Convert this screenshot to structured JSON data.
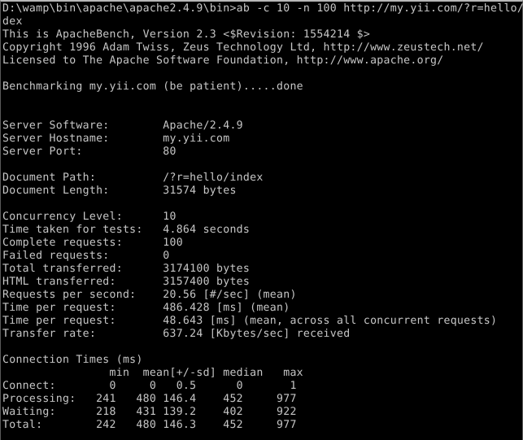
{
  "terminal": {
    "window_kind": "windows-command-prompt",
    "columns": 80,
    "background_color": "#000000",
    "foreground_color": "#c6c6c6",
    "border_color": "#b8b8b8"
  },
  "prompt": {
    "path": "D:\\wamp\\bin\\apache\\apache2.4.9\\bin",
    "symbol": ">",
    "command": "ab -c 10 -n 100 http://my.yii.com/?r=hello/index"
  },
  "banner": {
    "version_line": "This is ApacheBench, Version 2.3 <$Revision: 1554214 $>",
    "copyright_line": "Copyright 1996 Adam Twiss, Zeus Technology Ltd, http://www.zeustech.net/",
    "license_line": "Licensed to The Apache Software Foundation, http://www.apache.org/"
  },
  "progress": {
    "line": "Benchmarking my.yii.com (be patient).....done"
  },
  "server_info": [
    {
      "label": "Server Software:",
      "value": "Apache/2.4.9"
    },
    {
      "label": "Server Hostname:",
      "value": "my.yii.com"
    },
    {
      "label": "Server Port:",
      "value": "80"
    }
  ],
  "document_info": [
    {
      "label": "Document Path:",
      "value": "/?r=hello/index"
    },
    {
      "label": "Document Length:",
      "value": "31574 bytes"
    }
  ],
  "results": [
    {
      "label": "Concurrency Level:",
      "value": "10"
    },
    {
      "label": "Time taken for tests:",
      "value": "4.864 seconds"
    },
    {
      "label": "Complete requests:",
      "value": "100"
    },
    {
      "label": "Failed requests:",
      "value": "0"
    },
    {
      "label": "Total transferred:",
      "value": "3174100 bytes"
    },
    {
      "label": "HTML transferred:",
      "value": "3157400 bytes"
    },
    {
      "label": "Requests per second:",
      "value": "20.56 [#/sec] (mean)"
    },
    {
      "label": "Time per request:",
      "value": "486.428 [ms] (mean)"
    },
    {
      "label": "Time per request:",
      "value": "48.643 [ms] (mean, across all concurrent requests)"
    },
    {
      "label": "Transfer rate:",
      "value": "637.24 [Kbytes/sec] received"
    }
  ],
  "connection_times": {
    "title": "Connection Times (ms)",
    "columns": [
      "",
      "min",
      "mean[+/-sd]",
      "median",
      "max"
    ],
    "rows": [
      {
        "label": "Connect:",
        "min": "0",
        "mean": "0",
        "sd": "0.5",
        "median": "0",
        "max": "1"
      },
      {
        "label": "Processing:",
        "min": "241",
        "mean": "480",
        "sd": "146.4",
        "median": "452",
        "max": "977"
      },
      {
        "label": "Waiting:",
        "min": "218",
        "mean": "431",
        "sd": "139.2",
        "median": "402",
        "max": "922"
      },
      {
        "label": "Total:",
        "min": "242",
        "mean": "480",
        "sd": "146.3",
        "median": "452",
        "max": "977"
      }
    ]
  }
}
